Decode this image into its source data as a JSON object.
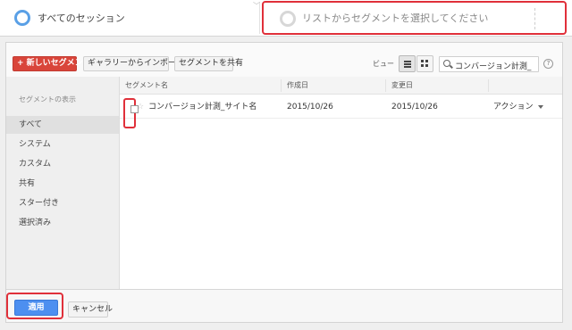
{
  "segments": {
    "slot1_label": "すべてのセッション",
    "slot2_placeholder": "リストからセグメントを選択してください"
  },
  "toolbar": {
    "new_segment": "+ 新しいセグメント",
    "import_gallery": "ギャラリーからインポート",
    "share_segment": "セグメントを共有",
    "view_label": "ビュー",
    "view_list_icon": "list-view-icon",
    "view_grid_icon": "grid-view-icon",
    "search_value": "コンバージョン計測_",
    "help_icon": "help-icon"
  },
  "sidebar": {
    "heading": "セグメントの表示",
    "items": [
      {
        "label": "すべて",
        "active": true
      },
      {
        "label": "システム",
        "active": false
      },
      {
        "label": "カスタム",
        "active": false
      },
      {
        "label": "共有",
        "active": false
      },
      {
        "label": "スター付き",
        "active": false
      },
      {
        "label": "選択済み",
        "active": false
      }
    ]
  },
  "table": {
    "columns": [
      "セグメント名",
      "作成日",
      "変更日",
      ""
    ],
    "rows": [
      {
        "name": "コンバージョン計測_サイト名",
        "created": "2015/10/26",
        "modified": "2015/10/26",
        "action": "アクション"
      }
    ]
  },
  "footer": {
    "apply": "適用",
    "cancel": "キャンセル"
  },
  "colors": {
    "highlight": "#e0303a",
    "primary_red": "#d9453a",
    "primary_blue": "#4d8ff0",
    "ring_blue": "#5aa0e6"
  }
}
